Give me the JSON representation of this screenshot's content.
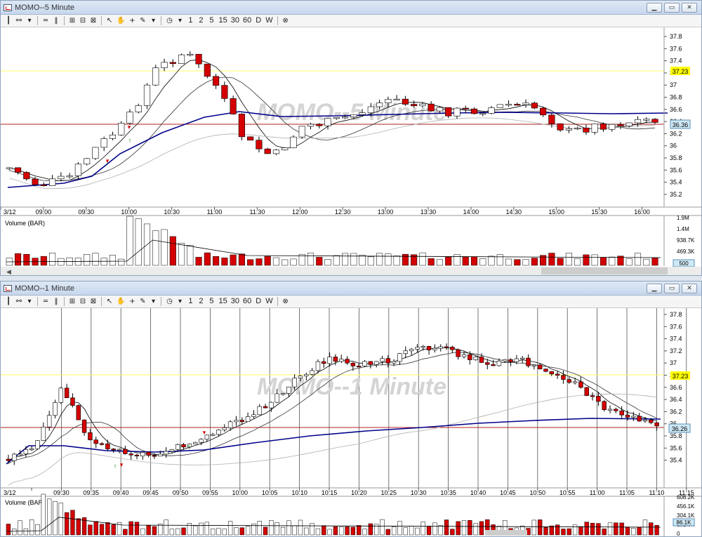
{
  "top": {
    "title": "MOMO--5 Minute",
    "watermark": "MOMO--5 Minute",
    "price_ticks": [
      "37.8",
      "37.6",
      "37.4",
      "37.2",
      "37",
      "36.8",
      "36.6",
      "36.4",
      "36.2",
      "36",
      "35.8",
      "35.6",
      "35.4",
      "35.2"
    ],
    "level_label": "37.23",
    "last_label": "36.36",
    "time_ticks": [
      "3/12",
      "09:00",
      "09:30",
      "10:00",
      "10:30",
      "11:00",
      "11:30",
      "12:00",
      "12:30",
      "13:00",
      "13:30",
      "14:00",
      "14:30",
      "15:00",
      "15:30",
      "16:00"
    ],
    "volume_label": "Volume (BAR)",
    "volume_ticks": [
      "1.9M",
      "1.4M",
      "938.7K",
      "469.3K"
    ],
    "volume_last": "500"
  },
  "bottom": {
    "title": "MOMO--1 Minute",
    "watermark": "MOMO--1 Minute",
    "price_ticks": [
      "37.8",
      "37.6",
      "37.4",
      "37.2",
      "37",
      "36.8",
      "36.6",
      "36.4",
      "36.2",
      "36",
      "35.8",
      "35.6",
      "35.4"
    ],
    "level_label": "37.23",
    "last_label": "36.26",
    "time_ticks": [
      "3/12",
      "09:30",
      "09:35",
      "09:40",
      "09:45",
      "09:50",
      "09:55",
      "10:00",
      "10:05",
      "10:10",
      "10:15",
      "10:20",
      "10:25",
      "10:30",
      "10:35",
      "10:40",
      "10:45",
      "10:50",
      "10:55",
      "11:00",
      "11:05",
      "11:10",
      "11:15"
    ],
    "volume_label": "Volume (BAR)",
    "volume_ticks": [
      "608.2K",
      "456.1K",
      "304.1K",
      "152.0K",
      "0"
    ],
    "volume_last": "86.1K"
  },
  "toolbar": {
    "interval_buttons": [
      "1",
      "2",
      "5",
      "15",
      "30",
      "60",
      "D",
      "W"
    ]
  },
  "colors": {
    "up": "#ffffff",
    "down": "#d40000",
    "ema_fast": "#000000",
    "vwap": "#00008b",
    "sma_slow": "#b0b0b0",
    "level_line": "#ffff66",
    "last_line": "#b22222",
    "label_level_bg": "#ffff00",
    "label_last_bg": "#cfe9f5"
  }
}
